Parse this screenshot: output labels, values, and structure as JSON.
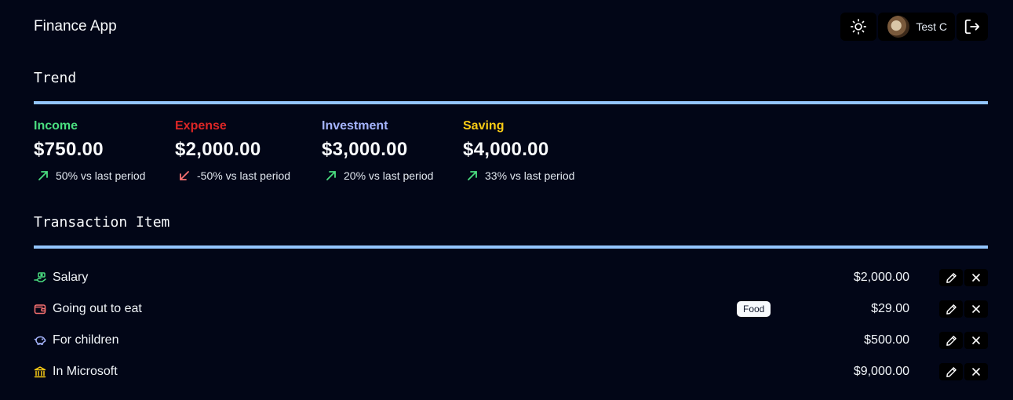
{
  "app": {
    "title": "Finance App"
  },
  "header": {
    "theme_icon": "sun-icon",
    "user_name": "Test C",
    "logout_icon": "logout-icon"
  },
  "trend": {
    "title": "Trend",
    "stats": [
      {
        "label": "Income",
        "value": "$750.00",
        "change": "50% vs last period",
        "direction": "up",
        "color": "#4ade80"
      },
      {
        "label": "Expense",
        "value": "$2,000.00",
        "change": "-50% vs last period",
        "direction": "down",
        "color": "#dc2626"
      },
      {
        "label": "Investment",
        "value": "$3,000.00",
        "change": "20% vs last period",
        "direction": "up",
        "color": "#a5b4fc"
      },
      {
        "label": "Saving",
        "value": "$4,000.00",
        "change": "33% vs last period",
        "direction": "up",
        "color": "#facc15"
      }
    ]
  },
  "transactions": {
    "title": "Transaction Item",
    "items": [
      {
        "description": "Salary",
        "category": "",
        "amount": "$2,000.00",
        "icon": "money-hand-icon",
        "color": "#4ade80"
      },
      {
        "description": "Going out to eat",
        "category": "Food",
        "amount": "$29.00",
        "icon": "wallet-icon",
        "color": "#f87171"
      },
      {
        "description": "For children",
        "category": "",
        "amount": "$500.00",
        "icon": "piggy-bank-icon",
        "color": "#a5b4fc"
      },
      {
        "description": "In Microsoft",
        "category": "",
        "amount": "$9,000.00",
        "icon": "bank-icon",
        "color": "#facc15"
      }
    ]
  }
}
